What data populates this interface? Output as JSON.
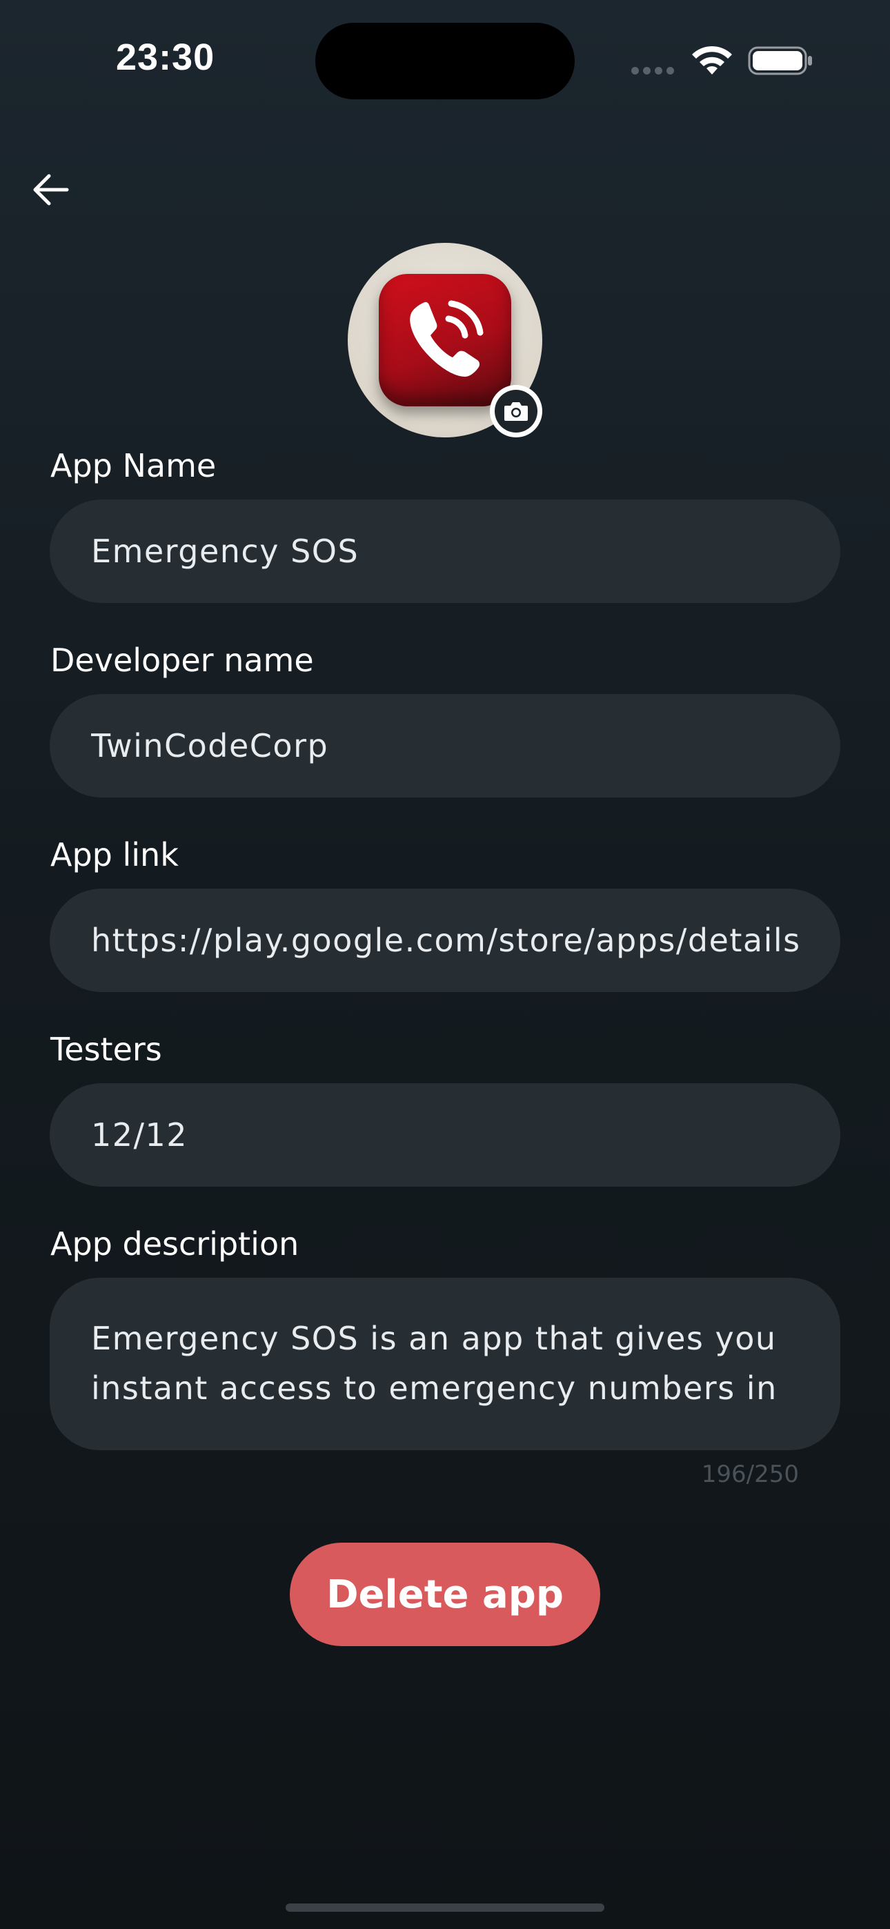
{
  "status_bar": {
    "time": "23:30"
  },
  "header": {
    "back_icon": "arrow-left-icon"
  },
  "app_icon": {
    "icon": "phone-ringing-icon",
    "accent": "#c81020",
    "edit_icon": "camera-icon"
  },
  "form": {
    "app_name": {
      "label": "App Name",
      "value": "Emergency SOS"
    },
    "developer_name": {
      "label": "Developer name",
      "value": "TwinCodeCorp"
    },
    "app_link": {
      "label": "App link",
      "value": "https://play.google.com/store/apps/details?"
    },
    "testers": {
      "label": "Testers",
      "value": "12/12"
    },
    "app_description": {
      "label": "App description",
      "value": "Emergency SOS is an app that gives you instant access to emergency numbers in",
      "counter": "196/250"
    }
  },
  "actions": {
    "delete_label": "Delete app",
    "delete_color": "#d85a5c"
  }
}
